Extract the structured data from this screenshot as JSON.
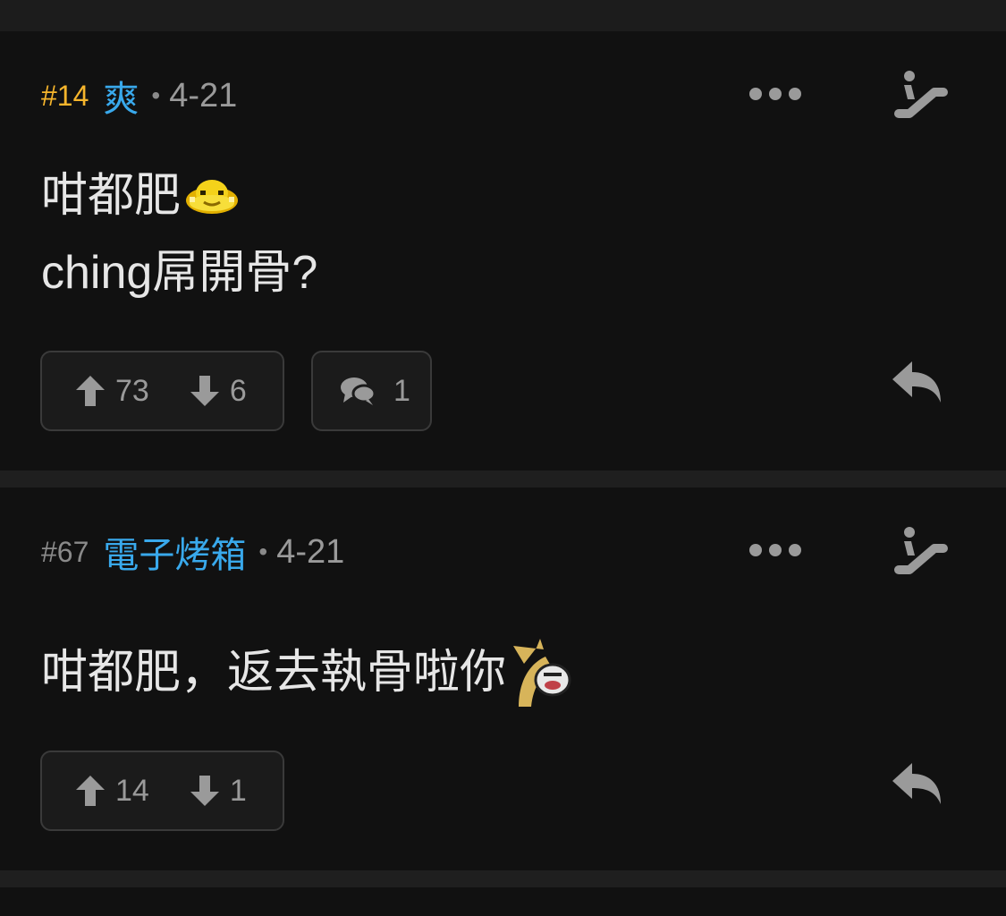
{
  "posts": [
    {
      "floor": "#14",
      "username": "爽",
      "separator": "•",
      "date": "4-21",
      "content_lines": [
        "咁都肥",
        "ching屌開骨?"
      ],
      "emoji_after_line": 0,
      "emoji_name": "yellow-blob-emoji",
      "upvotes": "73",
      "downvotes": "6",
      "comments": "1"
    },
    {
      "floor": "#67",
      "username": "電子烤箱",
      "separator": "•",
      "date": "4-21",
      "content_lines": [
        "咁都肥，返去執骨啦你"
      ],
      "emoji_name": "horn-laughing-emoji",
      "upvotes": "14",
      "downvotes": "1"
    }
  ],
  "colors": {
    "page_background": "#1f1f1f",
    "card_background": "#111111",
    "floor_op": "#f6b52c",
    "floor_normal": "#8a8a8a",
    "username": "#39a9ec",
    "text": "#e6e6e6",
    "muted": "#9a9a9a"
  },
  "icons": {
    "more": "more-dots-icon",
    "escalator": "escalator-icon",
    "upvote": "arrow-up-icon",
    "downvote": "arrow-down-icon",
    "comment": "speech-bubbles-icon",
    "reply": "reply-icon"
  }
}
